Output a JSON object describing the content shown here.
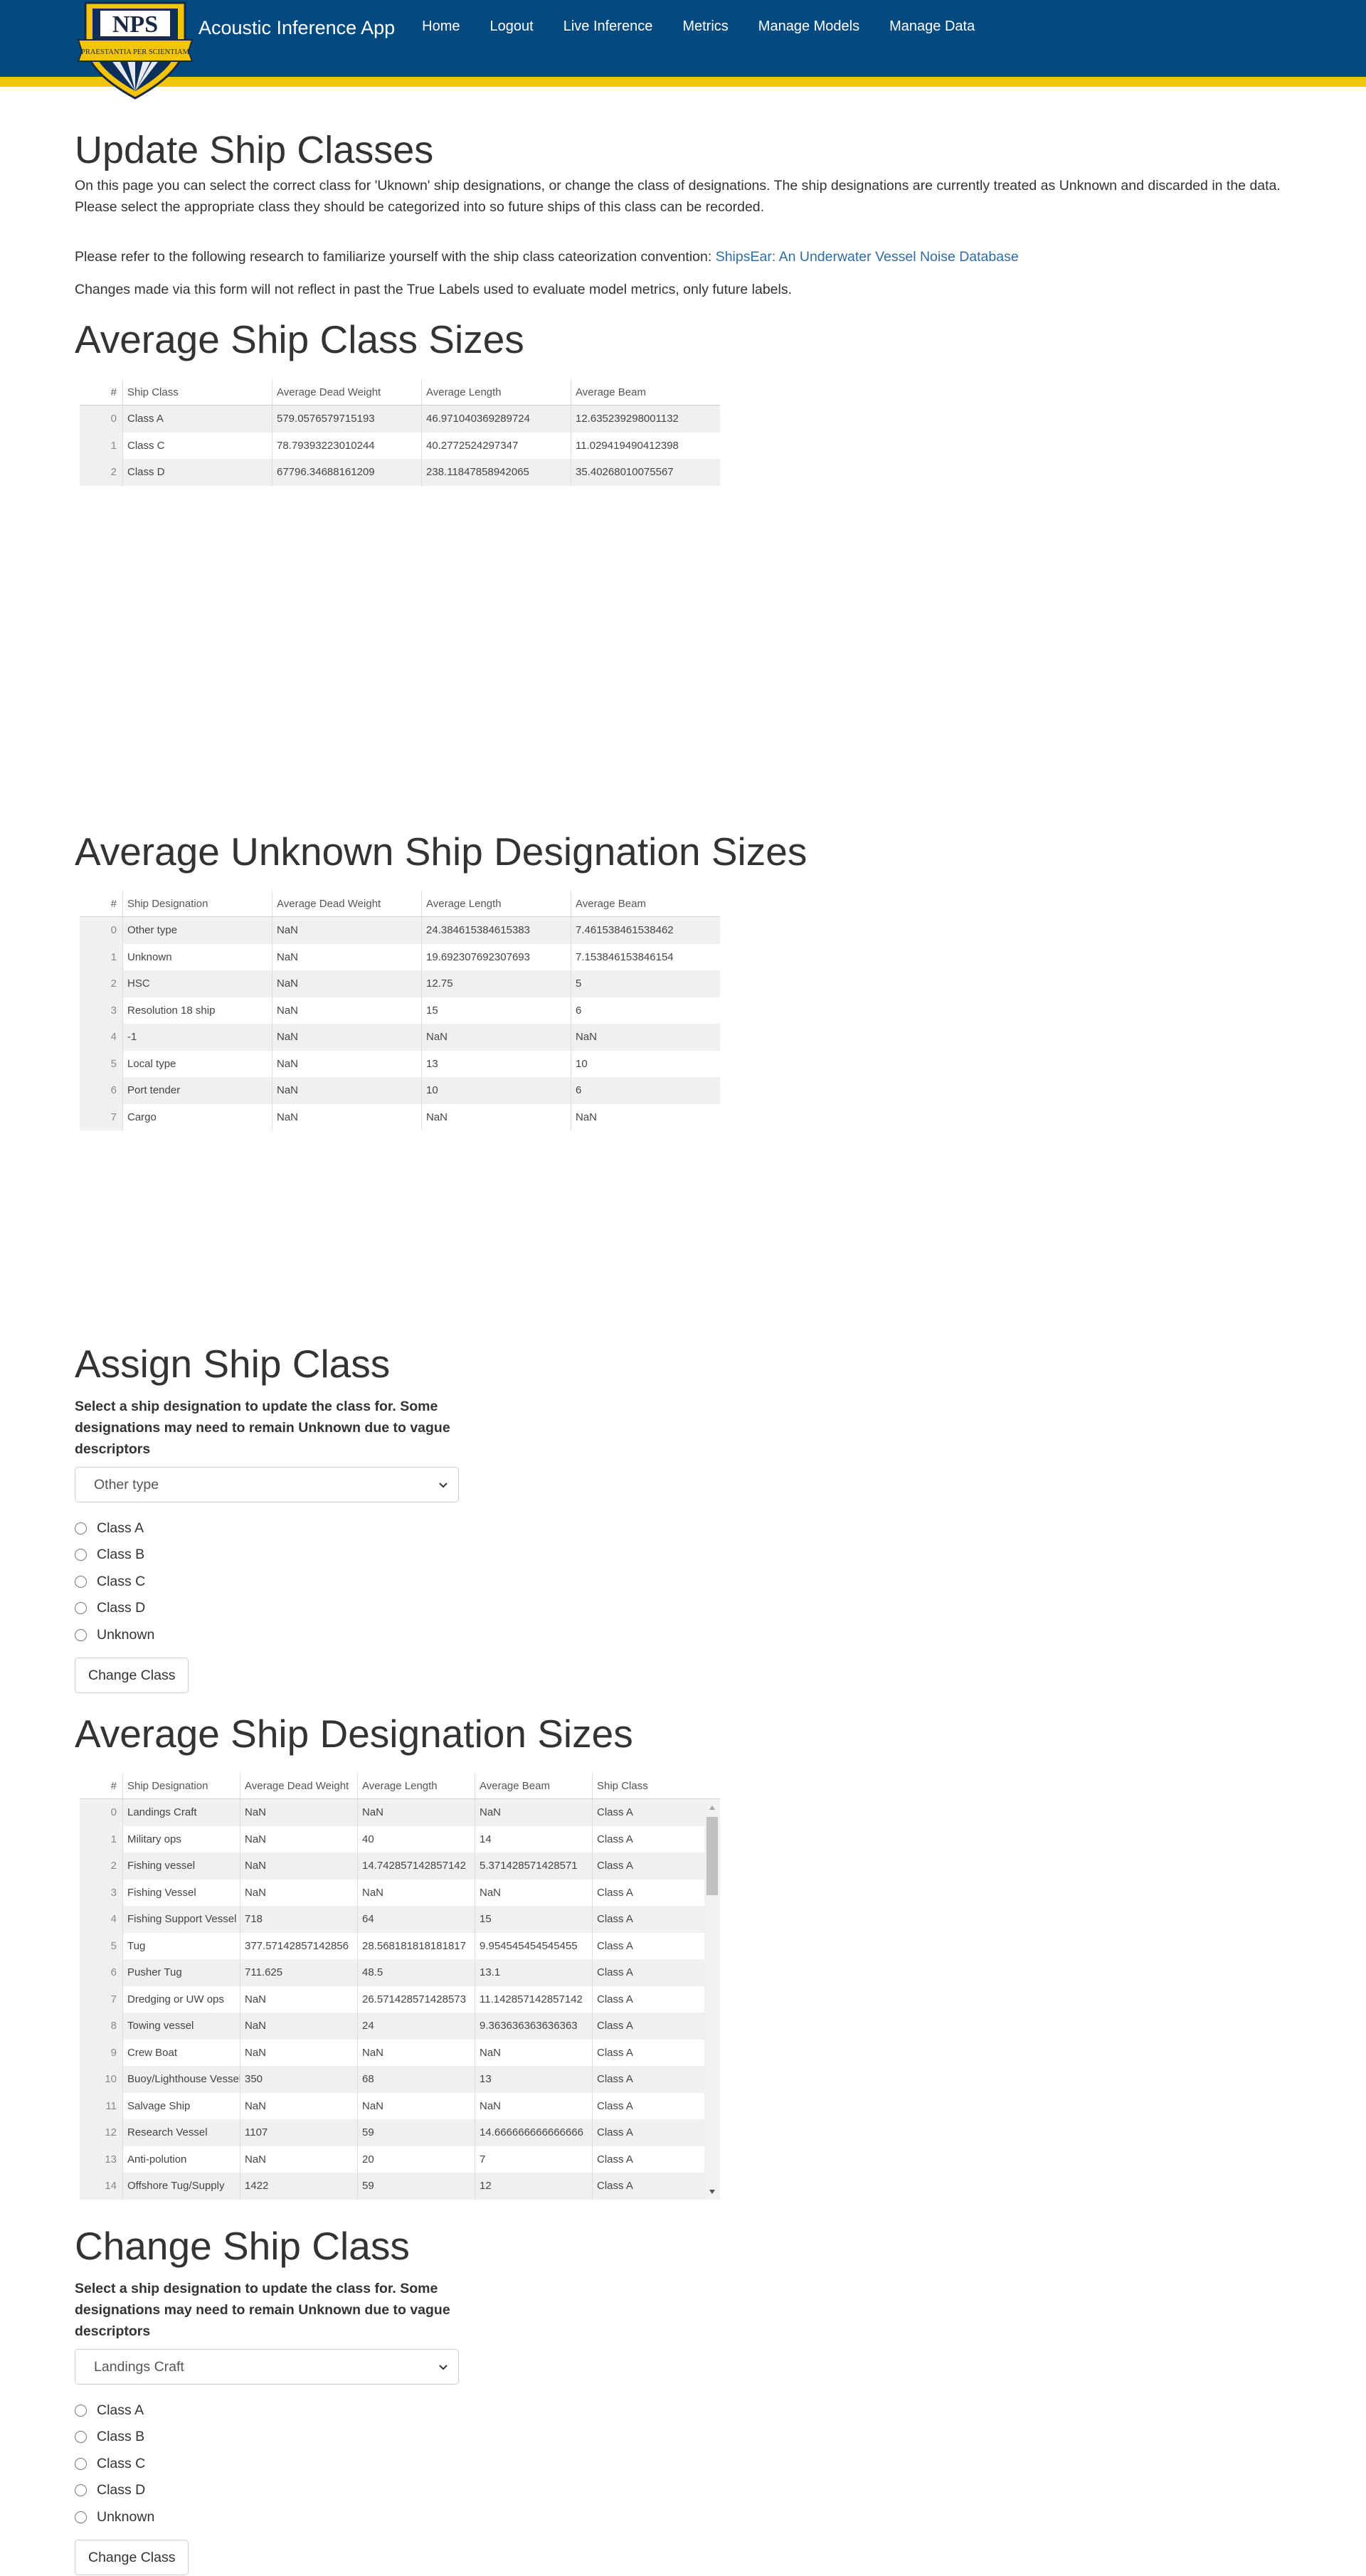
{
  "navbar": {
    "brand": "Acoustic Inference App",
    "logo_text": "NPS",
    "logo_motto": "PRAESTANTIA PER SCIENTIAM",
    "links": [
      "Home",
      "Logout",
      "Live Inference",
      "Metrics",
      "Manage Models",
      "Manage Data"
    ]
  },
  "page": {
    "title": "Update Ship Classes",
    "intro": "On this page you can select the correct class for 'Uknown' ship designations, or change the class of designations. The ship designations are currently treated as Unknown and discarded in the data. Please select the appropriate class they should be categorized into so future ships of this class can be recorded.",
    "research_prefix": "Please refer to the following research to familiarize yourself with the ship class cateorization convention: ",
    "research_link": "ShipsEar: An Underwater Vessel Noise Database",
    "note": "Changes made via this form will not reflect in past the True Labels used to evaluate model metrics, only future labels."
  },
  "class_sizes": {
    "title": "Average Ship Class Sizes",
    "columns": [
      "#",
      "Ship Class",
      "Average Dead Weight",
      "Average Length",
      "Average Beam"
    ],
    "rows": [
      [
        "0",
        "Class A",
        "579.0576579715193",
        "46.971040369289724",
        "12.635239298001132"
      ],
      [
        "1",
        "Class C",
        "78.79393223010244",
        "40.2772524297347",
        "11.029419490412398"
      ],
      [
        "2",
        "Class D",
        "67796.34688161209",
        "238.11847858942065",
        "35.40268010075567"
      ]
    ]
  },
  "unknown_sizes": {
    "title": "Average Unknown Ship Designation Sizes",
    "columns": [
      "#",
      "Ship Designation",
      "Average Dead Weight",
      "Average Length",
      "Average Beam"
    ],
    "rows": [
      [
        "0",
        "Other type",
        "NaN",
        "24.384615384615383",
        "7.461538461538462"
      ],
      [
        "1",
        "Unknown",
        "NaN",
        "19.692307692307693",
        "7.153846153846154"
      ],
      [
        "2",
        "HSC",
        "NaN",
        "12.75",
        "5"
      ],
      [
        "3",
        "Resolution 18 ship",
        "NaN",
        "15",
        "6"
      ],
      [
        "4",
        "-1",
        "NaN",
        "NaN",
        "NaN"
      ],
      [
        "5",
        "Local type",
        "NaN",
        "13",
        "10"
      ],
      [
        "6",
        "Port tender",
        "NaN",
        "10",
        "6"
      ],
      [
        "7",
        "Cargo",
        "NaN",
        "NaN",
        "NaN"
      ]
    ]
  },
  "assign_form": {
    "title": "Assign Ship Class",
    "label": "Select a ship designation to update the class for. Some designations may need to remain Unknown due to vague descriptors",
    "selected": "Other type",
    "options": [
      "Class A",
      "Class B",
      "Class C",
      "Class D",
      "Unknown"
    ],
    "button": "Change Class"
  },
  "designation_sizes": {
    "title": "Average Ship Designation Sizes",
    "columns": [
      "#",
      "Ship Designation",
      "Average Dead Weight",
      "Average Length",
      "Average Beam",
      "Ship Class"
    ],
    "rows": [
      [
        "0",
        "Landings Craft",
        "NaN",
        "NaN",
        "NaN",
        "Class A"
      ],
      [
        "1",
        "Military ops",
        "NaN",
        "40",
        "14",
        "Class A"
      ],
      [
        "2",
        "Fishing vessel",
        "NaN",
        "14.742857142857142",
        "5.371428571428571",
        "Class A"
      ],
      [
        "3",
        "Fishing Vessel",
        "NaN",
        "NaN",
        "NaN",
        "Class A"
      ],
      [
        "4",
        "Fishing Support Vessel",
        "718",
        "64",
        "15",
        "Class A"
      ],
      [
        "5",
        "Tug",
        "377.57142857142856",
        "28.568181818181817",
        "9.954545454545455",
        "Class A"
      ],
      [
        "6",
        "Pusher Tug",
        "711.625",
        "48.5",
        "13.1",
        "Class A"
      ],
      [
        "7",
        "Dredging or UW ops",
        "NaN",
        "26.571428571428573",
        "11.142857142857142",
        "Class A"
      ],
      [
        "8",
        "Towing vessel",
        "NaN",
        "24",
        "9.363636363636363",
        "Class A"
      ],
      [
        "9",
        "Crew Boat",
        "NaN",
        "NaN",
        "NaN",
        "Class A"
      ],
      [
        "10",
        "Buoy/Lighthouse Vessel",
        "350",
        "68",
        "13",
        "Class A"
      ],
      [
        "11",
        "Salvage Ship",
        "NaN",
        "NaN",
        "NaN",
        "Class A"
      ],
      [
        "12",
        "Research Vessel",
        "1107",
        "59",
        "14.666666666666666",
        "Class A"
      ],
      [
        "13",
        "Anti-polution",
        "NaN",
        "20",
        "7",
        "Class A"
      ],
      [
        "14",
        "Offshore Tug/Supply",
        "1422",
        "59",
        "12",
        "Class A"
      ]
    ]
  },
  "change_form": {
    "title": "Change Ship Class",
    "label": "Select a ship designation to update the class for. Some designations may need to remain Unknown due to vague descriptors",
    "selected": "Landings Craft",
    "options": [
      "Class A",
      "Class B",
      "Class C",
      "Class D",
      "Unknown"
    ],
    "button": "Change Class"
  },
  "icons": {
    "logo": "nps-shield-logo",
    "select_chevron": "chevron-down-icon",
    "scroll_up": "triangle-up-icon",
    "scroll_down": "triangle-down-icon"
  },
  "colors": {
    "navbar": "#034a80",
    "navbar_stripe": "#f2c40c",
    "link": "#2e6da4",
    "zebra": "#f0f0f0"
  }
}
